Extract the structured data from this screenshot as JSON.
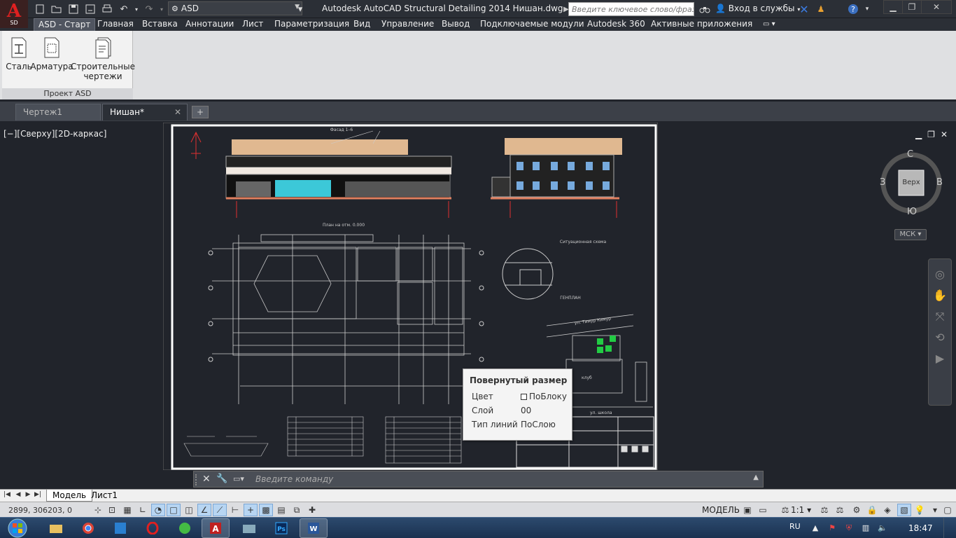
{
  "app": {
    "logo_letter": "A",
    "logo_sub": "SD",
    "workspace": "ASD",
    "title": "Autodesk AutoCAD Structural Detailing 2014    Нишан.dwg",
    "search_placeholder": "Введите ключевое слово/фразу",
    "login": "Вход в службы"
  },
  "ribbon": {
    "tabs": [
      {
        "label": "ASD - Старт",
        "active": true
      },
      {
        "label": "Главная"
      },
      {
        "label": "Вставка"
      },
      {
        "label": "Аннотации"
      },
      {
        "label": "Лист"
      },
      {
        "label": "Параметризация"
      },
      {
        "label": "Вид"
      },
      {
        "label": "Управление"
      },
      {
        "label": "Вывод"
      },
      {
        "label": "Подключаемые модули"
      },
      {
        "label": "Autodesk 360"
      },
      {
        "label": "Активные приложения"
      }
    ],
    "buttons": [
      {
        "label": "Сталь"
      },
      {
        "label": "Арматура"
      },
      {
        "label": "Строительные чертежи"
      }
    ],
    "group_label": "Проект ASD"
  },
  "file_tabs": [
    {
      "label": "Чертеж1"
    },
    {
      "label": "Нишан*",
      "active": true
    }
  ],
  "viewport": {
    "label": "[−][Сверху][2D-каркас]",
    "viewcube": {
      "top": "Верх",
      "north": "С",
      "south": "Ю",
      "east": "В",
      "west": "З"
    },
    "ucs": "МСК"
  },
  "drawing": {
    "facade_title": "Фасад 1–6",
    "plan_title": "План на отм. 0.000",
    "situation_title": "Ситуационная схема",
    "genplan_title": "ГЕНПЛАН",
    "street1": "ул. Тимур Кимур",
    "club": "клуб",
    "street2": "ул. школа"
  },
  "tooltip": {
    "title": "Повернутый размер",
    "rows": [
      {
        "label": "Цвет",
        "value": "ПоБлоку",
        "swatch": "#ffffff"
      },
      {
        "label": "Слой",
        "value": "00"
      },
      {
        "label": "Тип линий",
        "value": "ПоСлою"
      }
    ]
  },
  "cmdline": {
    "placeholder": "Введите команду"
  },
  "layout_tabs": [
    {
      "label": "Модель",
      "active": true
    },
    {
      "label": "Лист1"
    }
  ],
  "status": {
    "coords": "2899, 306203, 0",
    "model": "МОДЕЛЬ",
    "scale": "1:1"
  },
  "taskbar": {
    "lang": "RU",
    "time": "18:47"
  },
  "colors": {
    "accent_red": "#e02020",
    "background": "#21242b",
    "ribbon_active": "#505560"
  }
}
